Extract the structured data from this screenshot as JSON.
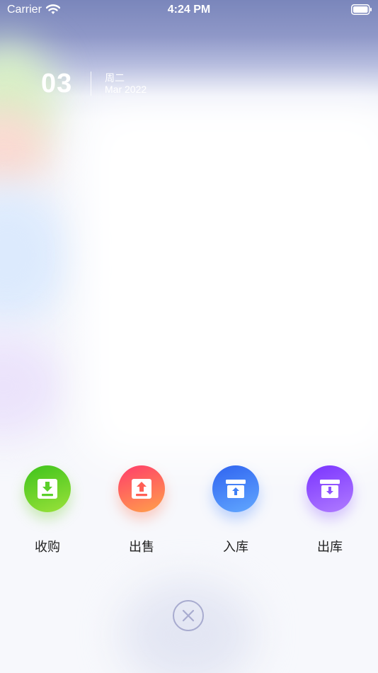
{
  "status_bar": {
    "carrier": "Carrier",
    "time": "4:24 PM"
  },
  "date": {
    "day": "03",
    "weekday": "周二",
    "month_year": "Mar 2022"
  },
  "actions": [
    {
      "label": "收购",
      "icon": "download-box-icon",
      "color": "#4cc726"
    },
    {
      "label": "出售",
      "icon": "upload-box-icon",
      "color": "#ff5a5f"
    },
    {
      "label": "入库",
      "icon": "inbox-up-icon",
      "color": "#3d7cf5"
    },
    {
      "label": "出库",
      "icon": "inbox-down-icon",
      "color": "#8b4dff"
    }
  ],
  "close": {
    "icon": "close-icon",
    "color": "#a8abcf"
  }
}
